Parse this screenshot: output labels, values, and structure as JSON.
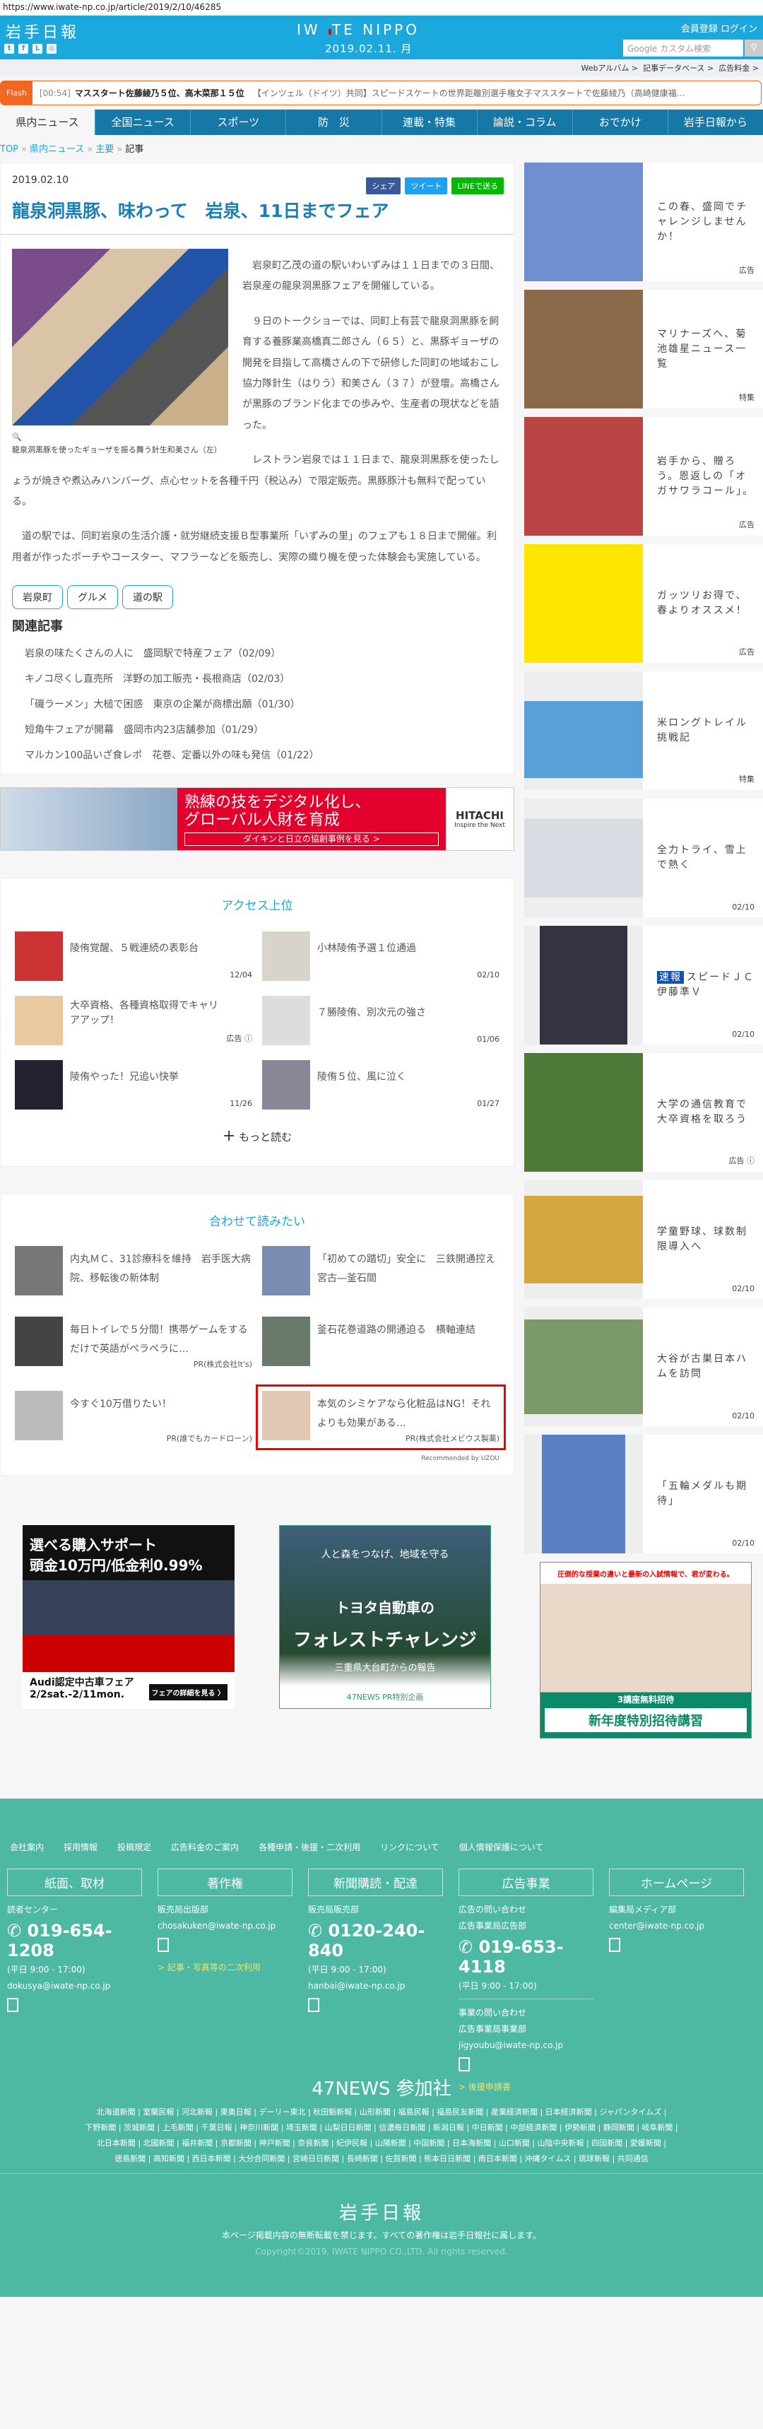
{
  "url": "https://www.iwate-np.co.jp/article/2019/2/10/46285",
  "header": {
    "logo": "岩手日報",
    "brand_left": "IW",
    "brand_right": "TE NIPPO",
    "date": "2019.02.11. 月",
    "register": "会員登録",
    "login": "ログイン",
    "search_placeholder": "Google カスタム検索",
    "social": [
      "t",
      "f",
      "L",
      "◎"
    ]
  },
  "subnav": [
    "Webアルバム >",
    "記事データベース >",
    "広告料金 >"
  ],
  "flash": {
    "label": "Flash",
    "time": "[00:54]",
    "headline": "マススタート佐藤綾乃５位、高木菜那１５位",
    "text": "【インツェル（ドイツ）共同】スピードスケートの世界距離別選手権女子マススタートで佐藤綾乃（高崎健康福…"
  },
  "nav": [
    "県内ニュース",
    "全国ニュース",
    "スポーツ",
    "防　災",
    "連載・特集",
    "論説・コラム",
    "おでかけ",
    "岩手日報から"
  ],
  "breadcrumb": [
    "TOP",
    "県内ニュース",
    "主要",
    "記事"
  ],
  "article": {
    "date": "2019.02.10",
    "share": {
      "facebook": "シェア",
      "twitter": "ツイート",
      "line": "LINEで送る"
    },
    "title": "龍泉洞黒豚、味わって　岩泉、11日までフェア",
    "caption": "龍泉洞黒豚を使ったギョーザを振る舞う針生和美さん（左）",
    "paragraphs": [
      "岩泉町乙茂の道の駅いわいずみは１１日までの３日間、岩泉産の龍泉洞黒豚フェアを開催している。",
      "９日のトークショーでは、同町上有芸で龍泉洞黒豚を飼育する養豚業高橋真二郎さん（６５）と、黒豚ギョーザの開発を目指して高橋さんの下で研修した同町の地域おこし協力隊針生（はりう）和美さん（３７）が登壇。高橋さんが黒豚のブランド化までの歩みや、生産者の現状などを語った。",
      "レストラン岩泉では１１日まで、龍泉洞黒豚を使ったしょうが焼きや煮込みハンバーグ、点心セットを各種千円（税込み）で限定販売。黒豚豚汁も無料で配っている。",
      "道の駅では、同町岩泉の生活介護・就労継続支援Ｂ型事業所「いずみの里」のフェアも１８日まで開催。利用者が作ったポーチやコースター、マフラーなどを販売し、実際の織り機を使った体験会も実施している。"
    ],
    "tags": [
      "岩泉町",
      "グルメ",
      "道の駅"
    ],
    "related_title": "関連記事",
    "related": [
      "岩泉の味たくさんの人に　盛岡駅で特産フェア（02/09）",
      "キノコ尽くし直売所　洋野の加工販売・長根商店（02/03）",
      "「磯ラーメン」大槌で困惑　東京の企業が商標出願（01/30）",
      "短角牛フェアが開幕　盛岡市内23店舗参加（01/29）",
      "マルカン100品いざ食レポ　花巻、定番以外の味も発信（01/22）"
    ]
  },
  "banner_ad": {
    "line1": "熟練の技をデジタル化し、",
    "line2": "グローバル人財を育成",
    "cta": "ダイキンと日立の協創事例を見る >",
    "brand": "HITACHI",
    "tagline": "Inspire the Next"
  },
  "access": {
    "title": "アクセス上位",
    "more": "もっと読む",
    "items": [
      {
        "title": "陵侑覚醒、５戦連続の表彰台",
        "meta": "12/04"
      },
      {
        "title": "小林陵侑予選１位通過",
        "meta": "02/10"
      },
      {
        "title": "大卒資格、各種資格取得でキャリアアップ！",
        "meta": "広告 ⓘ"
      },
      {
        "title": "７勝陵侑、別次元の強さ",
        "meta": "01/06"
      },
      {
        "title": "陵侑やった！兄追い快挙",
        "meta": "11/26"
      },
      {
        "title": "陵侑５位、風に泣く",
        "meta": "01/27"
      }
    ]
  },
  "read": {
    "title": "合わせて読みたい",
    "recommended": "Recommended by UZOU",
    "items": [
      {
        "title": "内丸ＭＣ、31診療科を維持　岩手医大病院、移転後の新体制",
        "pr": ""
      },
      {
        "title": "「初めての踏切」安全に　三鉄開通控え宮古―釜石間",
        "pr": ""
      },
      {
        "title": "毎日トイレで５分間！携帯ゲームをするだけで英語がペラペラに…",
        "pr": "PR(株式会社It's)"
      },
      {
        "title": "釜石花巻道路の開通迫る　横軸連結",
        "pr": ""
      },
      {
        "title": "今すぐ10万借りたい！",
        "pr": "PR(誰でもカードローン)"
      },
      {
        "title": "本気のシミケアなら化粧品はNG！それよりも効果がある…",
        "pr": "PR(株式会社メビウス製薬)"
      }
    ]
  },
  "ads": {
    "audi": {
      "line1": "選べる購入サポート",
      "line2": "頭金10万円/低金利0.99%",
      "line3": "Audi認定中古車フェア",
      "line4": "2/2sat.-2/11mon.",
      "btn": "フェアの詳細を見る 〉"
    },
    "toyota": {
      "a": "人と森をつなげ、地域を守る",
      "b": "トヨタ自動車の",
      "c": "フォレストチャレンジ",
      "d": "三重県大台町からの報告",
      "e": "47NEWS PR特別企画"
    },
    "school": {
      "t": "圧倒的な授業の違いと最新の入試情報で、君が変わる。",
      "m": "3講座無料招待",
      "n": "新年度特別招待講習"
    }
  },
  "sidebar": [
    {
      "title": "この春、盛岡でチャレンジしませんか！",
      "meta": "広告"
    },
    {
      "title": "マリナーズへ、菊池雄星ニュース一覧",
      "meta": "特集"
    },
    {
      "title": "岩手から、贈ろう。恩返しの「オガサワラコール」。",
      "meta": "広告"
    },
    {
      "title": "ガッツリお得で、春よりオススメ！",
      "meta": "広告"
    },
    {
      "title": "米ロングトレイル挑戦記",
      "meta": "特集"
    },
    {
      "title": "全力トライ、雪上で熱く",
      "meta": "02/10"
    },
    {
      "badge": "速報",
      "title": "スピードＪＣ伊藤準Ｖ",
      "meta": "02/10"
    },
    {
      "title": "大学の通信教育で大卒資格を取ろう",
      "meta": "広告 ⓘ"
    },
    {
      "title": "学童野球、球数制限導入へ",
      "meta": "02/10"
    },
    {
      "title": "大谷が古巣日本ハムを訪問",
      "meta": "02/10"
    },
    {
      "title": "「五輪メダルも期待」",
      "meta": "02/10"
    }
  ],
  "footer": {
    "links": [
      "会社案内",
      "採用情報",
      "投稿規定",
      "広告料金のご案内",
      "各種申請・後援・二次利用",
      "リンクについて",
      "個人情報保護について"
    ],
    "cols": [
      {
        "head": "紙面、取材",
        "dept": "読者センター",
        "tel": "019-654-1208",
        "hours": "(平日 9:00 - 17:00)",
        "email": "dokusya@iwate-np.co.jp"
      },
      {
        "head": "著作権",
        "dept": "販売局出版部",
        "email": "chosakuken@iwate-np.co.jp",
        "link": "> 記事・写真等の二次利用"
      },
      {
        "head": "新聞購読・配達",
        "dept": "販売局販売部",
        "tel": "0120-240-840",
        "hours": "(平日 9:00 - 17:00)",
        "email": "hanbai@iwate-np.co.jp"
      },
      {
        "head": "広告事業",
        "dept": "広告の問い合わせ",
        "dept2": "広告事業局広告部",
        "tel": "019-653-4118",
        "hours": "(平日 9:00 - 17:00)",
        "dept3": "事業の問い合わせ",
        "dept4": "広告事業局事業部",
        "email": "jigyoubu@iwate-np.co.jp",
        "link": "> 後援申請書"
      },
      {
        "head": "ホームページ",
        "dept": "編集局メディア部",
        "email": "center@iwate-np.co.jp"
      }
    ],
    "news_title": "47NEWS 参加社",
    "news_lines": [
      "北海道新聞 | 室蘭民報 | 河北新報 | 東奥日報 | デーリー東北 | 秋田魁新報 | 山形新聞 | 福島民報 | 福島民友新聞 | 産業経済新聞 | 日本経済新聞 | ジャパンタイムズ |",
      "下野新聞 | 茨城新聞 | 上毛新聞 | 千葉日報 | 神奈川新聞 | 埼玉新聞 | 山梨日日新聞 | 信濃毎日新聞 | 新潟日報 | 中日新聞 | 中部経済新聞 | 伊勢新聞 | 静岡新聞 | 岐阜新聞 |",
      "北日本新聞 | 北國新聞 | 福井新聞 | 京都新聞 | 神戸新聞 | 奈良新聞 | 紀伊民報 | 山陽新聞 | 中国新聞 | 日本海新聞 | 山口新聞 | 山陰中央新報 | 四国新聞 | 愛媛新聞 |",
      "徳島新聞 | 高知新聞 | 西日本新聞 | 大分合同新聞 | 宮崎日日新聞 | 長崎新聞 | 佐賀新聞 | 熊本日日新聞 | 南日本新聞 | 沖縄タイムス | 琉球新報 | 共同通信"
    ],
    "logo": "岩手日報",
    "notice": "本ページ掲載内容の無断転載を禁じます。すべての著作権は岩手日報社に属します。",
    "copyright": "Copyright©2019, IWATE NIPPO CO.,LTD. All rights reserved."
  }
}
